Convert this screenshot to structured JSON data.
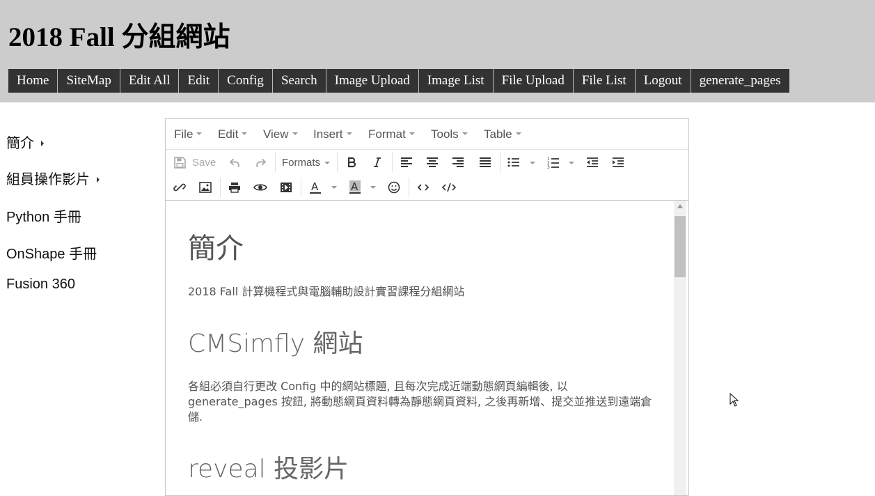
{
  "header": {
    "title": "2018 Fall 分組網站",
    "nav": [
      "Home",
      "SiteMap",
      "Edit All",
      "Edit",
      "Config",
      "Search",
      "Image Upload",
      "Image List",
      "File Upload",
      "File List",
      "Logout",
      "generate_pages"
    ]
  },
  "sidebar": {
    "items": [
      {
        "label": "簡介",
        "has_submenu": true
      },
      {
        "label": "組員操作影片",
        "has_submenu": true
      },
      {
        "label": "Python 手冊",
        "has_submenu": false
      },
      {
        "label": "OnShape 手冊",
        "has_submenu": false
      },
      {
        "label": "Fusion 360",
        "has_submenu": false
      }
    ]
  },
  "editor": {
    "menubar": [
      "File",
      "Edit",
      "View",
      "Insert",
      "Format",
      "Tools",
      "Table"
    ],
    "toolbar": {
      "save_label": "Save",
      "formats_label": "Formats",
      "icons": [
        "save-icon",
        "undo-icon",
        "redo-icon",
        "bold-icon",
        "italic-icon",
        "align-left-icon",
        "align-center-icon",
        "align-right-icon",
        "align-justify-icon",
        "bullet-list-icon",
        "numbered-list-icon",
        "outdent-icon",
        "indent-icon",
        "link-icon",
        "image-icon",
        "print-icon",
        "preview-icon",
        "media-icon",
        "text-color-icon",
        "background-color-icon",
        "emoticons-icon",
        "code-icon",
        "source-code-icon"
      ]
    },
    "content": {
      "h1": "簡介",
      "p1": "2018 Fall 計算機程式與電腦輔助設計實習課程分組網站",
      "h2a": "CMSimfly 網站",
      "p2": "各組必須自行更改 Config 中的網站標題, 且每次完成近端動態網頁編輯後, 以 generate_pages 按鈕, 將動態網頁資料轉為靜態網頁資料, 之後再新增、提交並推送到遠端倉儲.",
      "h2b": "reveal 投影片"
    }
  },
  "colors": {
    "header_bg": "#cccccc",
    "nav_bg": "#333333",
    "nav_text": "#ffffff",
    "editor_border": "#c5c5c5"
  }
}
